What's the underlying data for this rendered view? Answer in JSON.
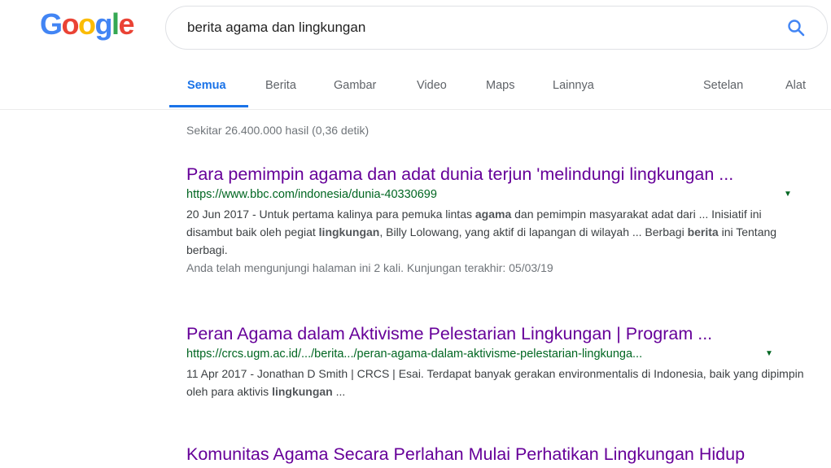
{
  "logo": {
    "letters": [
      "G",
      "o",
      "o",
      "g",
      "l",
      "e"
    ]
  },
  "search": {
    "query": "berita agama dan lingkungan"
  },
  "tabs": [
    {
      "label": "Semua",
      "active": true
    },
    {
      "label": "Berita"
    },
    {
      "label": "Gambar"
    },
    {
      "label": "Video"
    },
    {
      "label": "Maps"
    },
    {
      "label": "Lainnya"
    },
    {
      "label": "Setelan"
    },
    {
      "label": "Alat"
    }
  ],
  "stats": "Sekitar 26.400.000 hasil (0,36 detik)",
  "results": [
    {
      "title": "Para pemimpin agama dan adat dunia terjun 'melindungi lingkungan ...",
      "url": "https://www.bbc.com/indonesia/dunia-40330699",
      "snippet": [
        {
          "t": "20 Jun 2017 - Untuk pertama kalinya para pemuka lintas "
        },
        {
          "t": "agama",
          "b": true
        },
        {
          "t": " dan pemimpin masyarakat adat dari ... Inisiatif ini disambut baik oleh pegiat "
        },
        {
          "t": "lingkungan",
          "b": true
        },
        {
          "t": ", Billy Lolowang, yang aktif di lapangan di wilayah ... Berbagi "
        },
        {
          "t": "berita",
          "b": true
        },
        {
          "t": " ini Tentang berbagi."
        }
      ],
      "visited": "Anda telah mengunjungi halaman ini 2 kali. Kunjungan terakhir: 05/03/19"
    },
    {
      "title": "Peran Agama dalam Aktivisme Pelestarian Lingkungan | Program ...",
      "url": "https://crcs.ugm.ac.id/.../berita.../peran-agama-dalam-aktivisme-pelestarian-lingkunga...",
      "snippet": [
        {
          "t": "11 Apr 2017 - Jonathan D Smith | CRCS | Esai. Terdapat banyak gerakan environmentalis di Indonesia, baik yang dipimpin oleh para aktivis "
        },
        {
          "t": "lingkungan",
          "b": true
        },
        {
          "t": " ..."
        }
      ]
    },
    {
      "title": "Komunitas Agama Secara Perlahan Mulai Perhatikan Lingkungan Hidup"
    }
  ],
  "colors": {
    "link_visited": "#660099",
    "url_green": "#006621",
    "tab_active": "#1a73e8"
  }
}
